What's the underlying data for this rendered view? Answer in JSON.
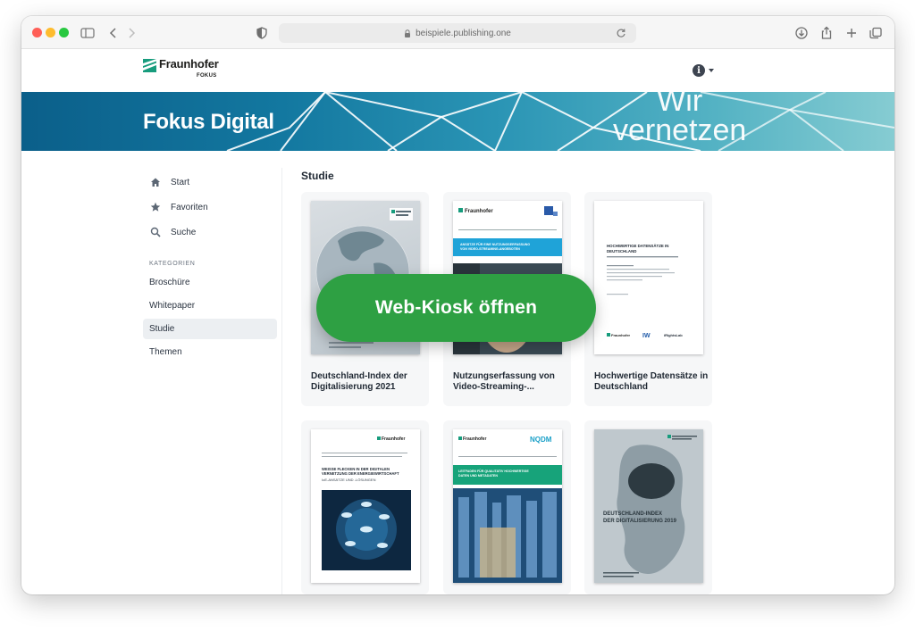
{
  "browser": {
    "url": "beispiele.publishing.one",
    "traffic_lights": [
      "#ff5f57",
      "#febc2e",
      "#28c840"
    ]
  },
  "header": {
    "logo_name": "Fraunhofer",
    "logo_sub": "FOKUS",
    "info_icon": "i",
    "accent": "#179c7d"
  },
  "banner": {
    "title": "Fokus Digital",
    "slogan_line1": "Wir",
    "slogan_line2": "vernetzen"
  },
  "sidebar": {
    "nav": [
      {
        "label": "Start",
        "icon": "home-icon"
      },
      {
        "label": "Favoriten",
        "icon": "star-icon"
      },
      {
        "label": "Suche",
        "icon": "search-icon"
      }
    ],
    "categories_header": "KATEGORIEN",
    "categories": [
      {
        "label": "Broschüre",
        "active": false
      },
      {
        "label": "Whitepaper",
        "active": false
      },
      {
        "label": "Studie",
        "active": true
      },
      {
        "label": "Themen",
        "active": false
      }
    ]
  },
  "main": {
    "section_title": "Studie",
    "cta_label": "Web-Kiosk öffnen",
    "cards": [
      {
        "title": "Deutschland-Index der Digitalisierung 2021"
      },
      {
        "title": "Nutzungserfassung von Video-Streaming-..."
      },
      {
        "title": "Hochwertige Datensätze in Deutschland"
      },
      {
        "title": ""
      },
      {
        "title": ""
      },
      {
        "title": ""
      }
    ],
    "cover_texts": {
      "c2_banner": "ANSÄTZE FÜR EINE NUTZUNGSERFASSUNG VON VIDEO-STREAMING-ANGEBOTEN",
      "c3_heading": "HOCHWERTIGE DATENSÄTZE IN DEUTSCHLAND",
      "c4_heading": "WEISSE FLECKEN IN DER DIGITALEN VERNETZUNG DER ENERGIEWIRTSCHAFT",
      "c4_sub": "IoE-ANSÄTZE UND -LÖSUNGEN",
      "c5_banner": "LEITFADEN FÜR QUALITATIV HOCHWERTIGE DATEN UND METADATEN",
      "c5_logo": "NQDM",
      "c6_heading": "DEUTSCHLAND-INDEX DER DIGITALISIERUNG 2019"
    }
  }
}
